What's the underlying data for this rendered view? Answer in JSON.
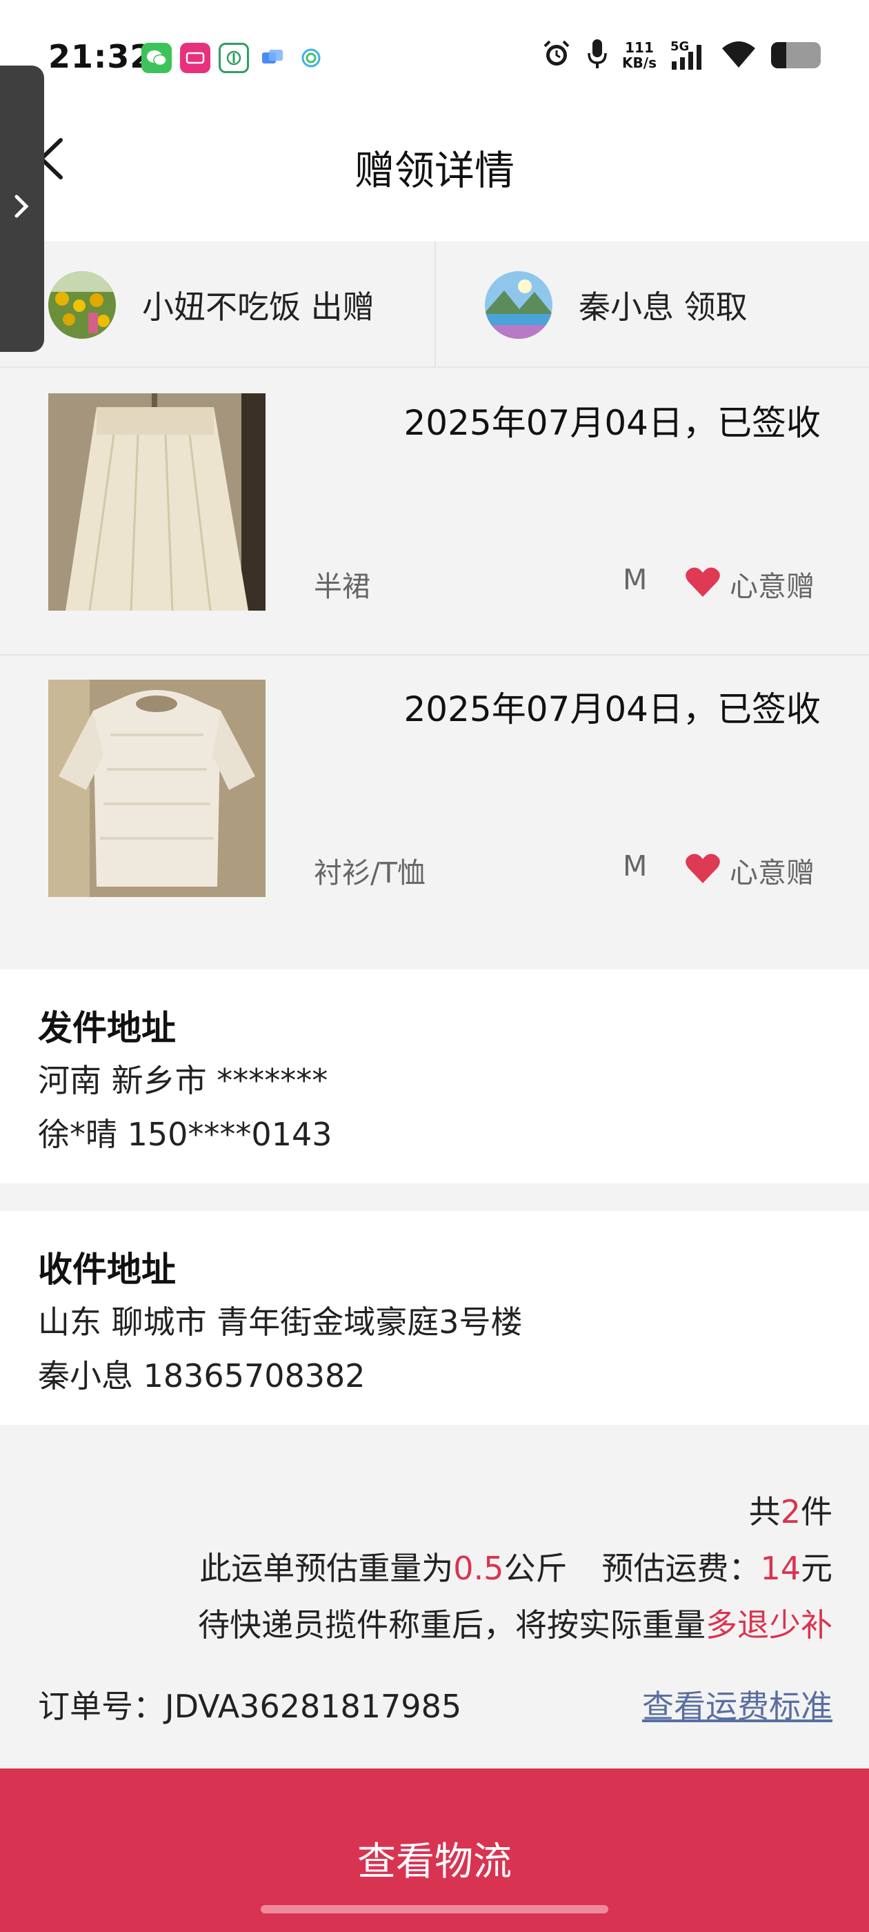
{
  "status_bar": {
    "time": "21:32",
    "net_speed_value": "111",
    "net_speed_unit": "KB/s",
    "network": "5G",
    "battery_level": 0.3,
    "notification_icons": [
      "wechat-icon",
      "vip-app-icon",
      "bank-app-icon",
      "message-app-icon",
      "china-mobile-icon"
    ]
  },
  "header": {
    "title": "赠领详情"
  },
  "parties": {
    "giver": "小妞不吃饭 出赠",
    "receiver": "秦小息 领取"
  },
  "items": [
    {
      "date_status": "2025年07月04日，已签收",
      "category": "半裙",
      "size": "M",
      "tag": "心意赠"
    },
    {
      "date_status": "2025年07月04日，已签收",
      "category": "衬衫/T恤",
      "size": "M",
      "tag": "心意赠"
    }
  ],
  "sender": {
    "title": "发件地址",
    "address": "河南 新乡市 *******",
    "contact": "徐*晴 150****0143"
  },
  "receiver_addr": {
    "title": "收件地址",
    "address": "山东 聊城市 青年街金域豪庭3号楼",
    "contact": "秦小息 18365708382"
  },
  "summary": {
    "count_prefix": "共",
    "count": "2",
    "count_suffix": "件",
    "weight_prefix": "此运单预估重量为",
    "weight": "0.5",
    "weight_unit": "公斤",
    "fee_prefix": "预估运费：",
    "fee": "14",
    "fee_unit": "元",
    "note_prefix": "待快递员揽件称重后，将按实际重量",
    "note_highlight": "多退少补",
    "order_label": "订单号：JDVA36281817985",
    "fee_link": "查看运费标准"
  },
  "bottom_button": {
    "label": "查看物流"
  },
  "colors": {
    "accent": "#d83452",
    "highlight_red": "#d9344f",
    "link": "#5a6fa0",
    "panel_gray": "#f3f3f3"
  }
}
